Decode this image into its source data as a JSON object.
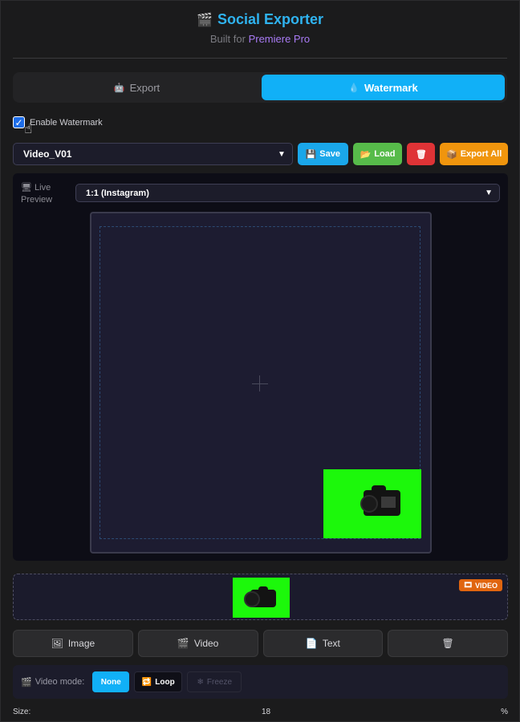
{
  "header": {
    "icon": "clapperboard-icon",
    "title": "Social Exporter",
    "subtitle_prefix": "Built for",
    "subtitle_highlight": "Premiere Pro"
  },
  "tabs": [
    {
      "label": "Export",
      "icon": "robot-icon",
      "active": false
    },
    {
      "label": "Watermark",
      "icon": "droplet-icon",
      "active": true
    }
  ],
  "enable_watermark": {
    "label": "Enable Watermark",
    "checked": true
  },
  "presets": {
    "selected": "Video_V01",
    "save_label": "Save",
    "load_label": "Load",
    "export_all_label": "Export All"
  },
  "preview": {
    "label": "Live Preview",
    "ratio_selected": "1:1 (Instagram)"
  },
  "source": {
    "badge": "VIDEO"
  },
  "source_buttons": [
    "Image",
    "Video",
    "Text"
  ],
  "video_mode": {
    "label": "Video mode:",
    "options": [
      "None",
      "Loop",
      "Freeze"
    ],
    "selected": "None"
  },
  "size": {
    "label": "Size:",
    "value": "18",
    "unit": "%"
  },
  "colors": {
    "accent": "#11b0f7",
    "title": "#2fb3f0",
    "highlight": "#a97bf5",
    "save": "#1aa7ea",
    "load": "#57bb4a",
    "delete": "#df3336",
    "export_all": "#f0950d",
    "badge": "#e0650f",
    "green_screen": "#1cf80b"
  }
}
